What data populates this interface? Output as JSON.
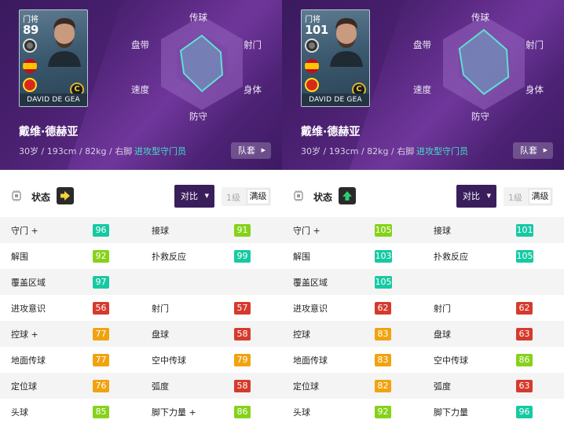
{
  "colors": {
    "teal": "#17c9a3",
    "green": "#86d21a",
    "orange": "#f0a30f",
    "red": "#d63a2c",
    "purple_dark": "#3a1e5c",
    "accent_text": "#43e0c6"
  },
  "panels": [
    {
      "card": {
        "position": "门将",
        "overall": "89",
        "name": "DAVID DE GEA",
        "rarity": "C"
      },
      "player_name": "戴维·德赫亚",
      "info": "30岁 / 193cm / 82kg / 右脚",
      "play_style": "进攻型守门员",
      "team_button": "队套",
      "radar": {
        "labels": [
          "传球",
          "射门",
          "身体",
          "防守",
          "速度",
          "盘带"
        ],
        "values": [
          0.58,
          0.46,
          0.5,
          0.6,
          0.44,
          0.52
        ]
      },
      "status_label": "状态",
      "condition_icon": "arrow-right-icon",
      "compare_button": "对比",
      "level_1": "1级",
      "level_max": "满级",
      "stats": [
        {
          "left": {
            "name": "守门 +",
            "value": "96",
            "color": "teal"
          },
          "right": {
            "name": "接球",
            "value": "91",
            "color": "green"
          }
        },
        {
          "left": {
            "name": "解围",
            "value": "92",
            "color": "green"
          },
          "right": {
            "name": "扑救反应",
            "value": "99",
            "color": "teal"
          }
        },
        {
          "left": {
            "name": "覆盖区域",
            "value": "97",
            "color": "teal"
          },
          "right": null
        },
        {
          "left": {
            "name": "进攻意识",
            "value": "56",
            "color": "red"
          },
          "right": {
            "name": "射门",
            "value": "57",
            "color": "red"
          }
        },
        {
          "left": {
            "name": "控球 +",
            "value": "77",
            "color": "orange"
          },
          "right": {
            "name": "盘球",
            "value": "58",
            "color": "red"
          }
        },
        {
          "left": {
            "name": "地面传球",
            "value": "77",
            "color": "orange"
          },
          "right": {
            "name": "空中传球",
            "value": "79",
            "color": "orange"
          }
        },
        {
          "left": {
            "name": "定位球",
            "value": "76",
            "color": "orange"
          },
          "right": {
            "name": "弧度",
            "value": "58",
            "color": "red"
          }
        },
        {
          "left": {
            "name": "头球",
            "value": "85",
            "color": "green"
          },
          "right": {
            "name": "脚下力量 +",
            "value": "86",
            "color": "green"
          }
        }
      ]
    },
    {
      "card": {
        "position": "门将",
        "overall": "101",
        "name": "DAVID DE GEA",
        "rarity": "C"
      },
      "player_name": "戴维·德赫亚",
      "info": "30岁 / 193cm / 82kg / 右脚",
      "play_style": "进攻型守门员",
      "team_button": "队套",
      "radar": {
        "labels": [
          "传球",
          "射门",
          "身体",
          "防守",
          "速度",
          "盘带"
        ],
        "values": [
          0.7,
          0.56,
          0.6,
          0.66,
          0.5,
          0.6
        ]
      },
      "status_label": "状态",
      "condition_icon": "arrow-up-icon",
      "compare_button": "对比",
      "level_1": "1级",
      "level_max": "满级",
      "stats": [
        {
          "left": {
            "name": "守门 +",
            "value": "105",
            "color": "green"
          },
          "right": {
            "name": "接球",
            "value": "101",
            "color": "teal"
          }
        },
        {
          "left": {
            "name": "解围",
            "value": "103",
            "color": "teal"
          },
          "right": {
            "name": "扑救反应",
            "value": "105",
            "color": "teal"
          }
        },
        {
          "left": {
            "name": "覆盖区域",
            "value": "105",
            "color": "teal"
          },
          "right": null
        },
        {
          "left": {
            "name": "进攻意识",
            "value": "62",
            "color": "red"
          },
          "right": {
            "name": "射门",
            "value": "62",
            "color": "red"
          }
        },
        {
          "left": {
            "name": "控球",
            "value": "83",
            "color": "orange"
          },
          "right": {
            "name": "盘球",
            "value": "63",
            "color": "red"
          }
        },
        {
          "left": {
            "name": "地面传球",
            "value": "83",
            "color": "orange"
          },
          "right": {
            "name": "空中传球",
            "value": "86",
            "color": "green"
          }
        },
        {
          "left": {
            "name": "定位球",
            "value": "82",
            "color": "orange"
          },
          "right": {
            "name": "弧度",
            "value": "63",
            "color": "red"
          }
        },
        {
          "left": {
            "name": "头球",
            "value": "92",
            "color": "green"
          },
          "right": {
            "name": "脚下力量",
            "value": "96",
            "color": "teal"
          }
        }
      ]
    }
  ]
}
